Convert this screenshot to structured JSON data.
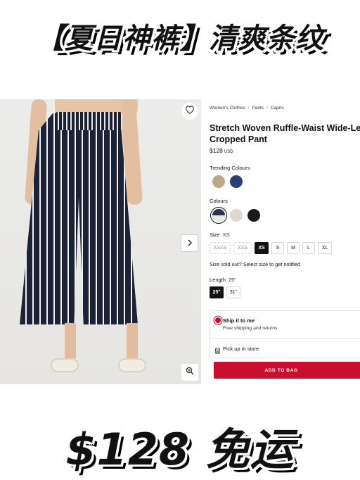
{
  "banner_top": "【夏日神裤】清爽条纹",
  "banner_bottom": "$128 免运",
  "breadcrumb": [
    "Women's Clothes",
    "Pants",
    "Capris"
  ],
  "breadcrumb_sep": "/",
  "product": {
    "name": "Stretch Woven Ruffle-Waist Wide-Leg Cropped Pant",
    "price": "$128",
    "currency": "USD"
  },
  "trending_colours": {
    "label": "Trending Colours",
    "swatches": [
      {
        "icon": "swatch-khaki",
        "color": "#b9a98a"
      },
      {
        "icon": "swatch-navy",
        "color": "#2a3f78"
      }
    ]
  },
  "colours": {
    "label": "Colours",
    "swatches": [
      {
        "icon": "swatch-navy-stripe",
        "color": "#2b3550",
        "selected": true
      },
      {
        "icon": "swatch-bone",
        "color": "#ded7cd"
      },
      {
        "icon": "swatch-black",
        "color": "#1a1a1a"
      }
    ]
  },
  "size": {
    "label": "Size",
    "selected": "XS",
    "options": [
      {
        "label": "XXXS",
        "available": false
      },
      {
        "label": "XXS",
        "available": false
      },
      {
        "label": "XS",
        "available": true,
        "active": true
      },
      {
        "label": "S",
        "available": true
      },
      {
        "label": "M",
        "available": true
      },
      {
        "label": "L",
        "available": true
      },
      {
        "label": "XL",
        "available": true
      }
    ]
  },
  "sold_out_text": "Size sold out? Select size to get notified",
  "length": {
    "label": "Length",
    "selected": "25\"",
    "options": [
      {
        "label": "25\"",
        "active": true
      },
      {
        "label": "31\""
      }
    ]
  },
  "shipping": {
    "title": "Ship it to me",
    "subtitle": "Free shipping and returns",
    "pickup": "Pick up in store"
  },
  "add_to_bag": "ADD TO BAG",
  "icons": {
    "wishlist": "heart-icon",
    "next": "chevron-right-icon",
    "zoom": "zoom-in-icon",
    "store": "store-icon"
  },
  "colors": {
    "accent": "#c8102e",
    "text": "#111111"
  }
}
